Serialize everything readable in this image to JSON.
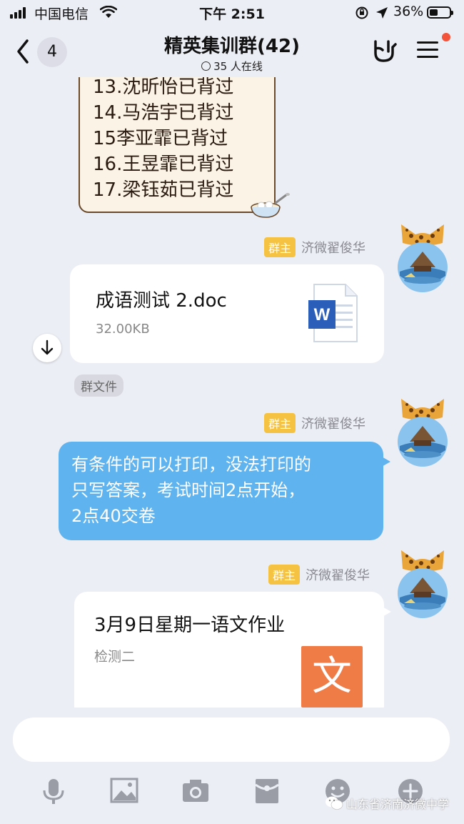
{
  "status_bar": {
    "carrier": "中国电信",
    "time": "下午 2:51",
    "battery_pct": "36%",
    "battery_level": 0.36
  },
  "nav": {
    "back_count": "4",
    "title": "精英集训群(42)",
    "online": "35 人在线"
  },
  "messages": {
    "list_lines": [
      "13.沈昕怡已背过",
      "14.马浩宇已背过",
      "15李亚霏已背过",
      "16.王昱霏已背过",
      "17.梁钰茹已背过"
    ],
    "sender_role": "群主",
    "sender_name": "济微翟俊华",
    "file": {
      "name": "成语测试 2.doc",
      "size": "32.00KB",
      "tag": "群文件",
      "icon_letter": "W"
    },
    "text": {
      "lines": [
        "有条件的可以打印，没法打印的",
        "只写答案，考试时间2点开始，",
        "2点40交卷"
      ]
    },
    "homework": {
      "title": "3月9日星期一语文作业",
      "subtitle": "检测二",
      "icon_char": "文"
    }
  },
  "watermark": "山东省济南济微中学",
  "colors": {
    "background": "#eceef5",
    "blue_bubble": "#5fb3ef",
    "role_badge": "#f5c341",
    "notification_dot": "#f2533a",
    "word_blue": "#2b5eb8",
    "homework_icon": "#ef7b46"
  },
  "icons": [
    "back-chevron-icon",
    "gesture-hand-icon",
    "menu-icon",
    "download-icon",
    "microphone-icon",
    "image-icon",
    "camera-icon",
    "red-packet-icon",
    "emoji-icon",
    "plus-icon"
  ]
}
